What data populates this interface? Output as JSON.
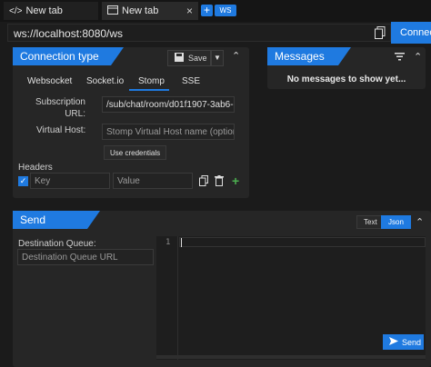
{
  "tabs": [
    {
      "label": "New tab"
    },
    {
      "label": "New tab"
    }
  ],
  "tab_close": "×",
  "add_tab": "+",
  "ws_button": "WS",
  "url": "ws://localhost:8080/ws",
  "connect_label": "Connect",
  "connection": {
    "title": "Connection type",
    "save_label": "Save",
    "protocols": [
      "Websocket",
      "Socket.io",
      "Stomp",
      "SSE"
    ],
    "active_protocol": "Stomp",
    "subscription_label": "Subscription URL:",
    "subscription_value": "/sub/chat/room/d01f1907-3ab6-...",
    "virtual_host_label": "Virtual Host:",
    "virtual_host_placeholder": "Stomp Virtual Host name (option",
    "use_credentials": "Use credentials",
    "headers_label": "Headers",
    "key_placeholder": "Key",
    "value_placeholder": "Value"
  },
  "messages": {
    "title": "Messages",
    "empty": "No messages to show yet..."
  },
  "send": {
    "title": "Send",
    "text_label": "Text",
    "json_label": "Json",
    "destination_label": "Destination Queue:",
    "destination_placeholder": "Destination Queue URL",
    "line_number": "1",
    "send_label": "Send"
  },
  "colors": {
    "accent": "#1f7ae0",
    "checkbox": "#1f7ae0",
    "add_header": "#4caf50"
  }
}
